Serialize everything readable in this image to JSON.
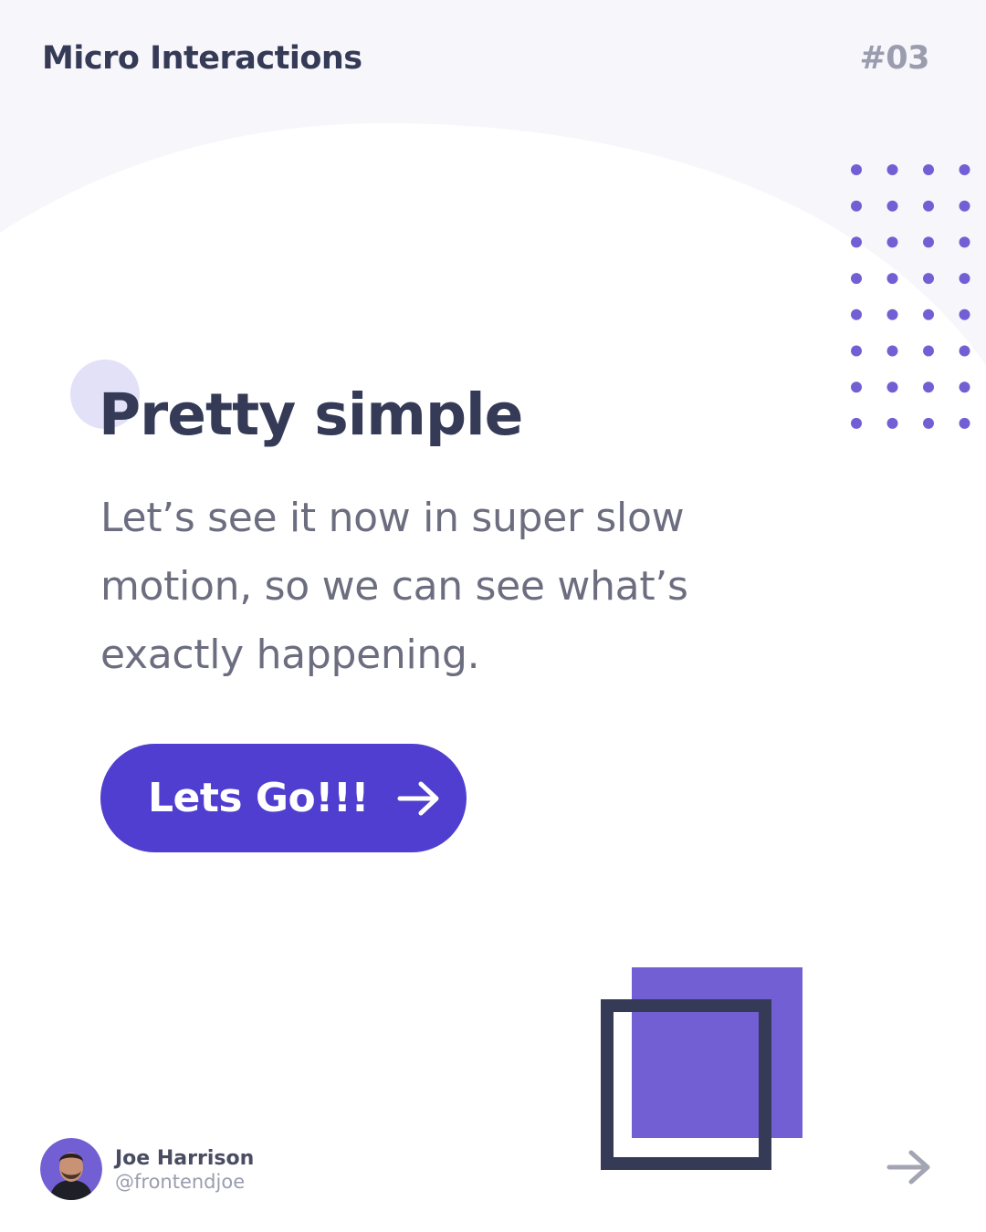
{
  "header": {
    "series_title": "Micro Interactions",
    "series_number": "#03"
  },
  "main": {
    "headline": "Pretty simple",
    "body": "Let’s see it now in super slow motion, so we can see what’s exactly happening.",
    "cta": {
      "label": "Lets Go!!!",
      "icon": "arrow-right-icon"
    }
  },
  "author": {
    "name": "Joe Harrison",
    "handle": "@frontendjoe",
    "avatar_icon": "avatar-photo"
  },
  "nav": {
    "next_icon": "arrow-right-icon"
  },
  "colors": {
    "primary": "#4f3ecf",
    "accent": "#735fd4",
    "dark": "#353a56",
    "muted_text": "#6c6e80",
    "light_background": "#f7f6fb",
    "accent_circle": "#e3e1f7",
    "next_arrow": "#a3a5b3"
  }
}
